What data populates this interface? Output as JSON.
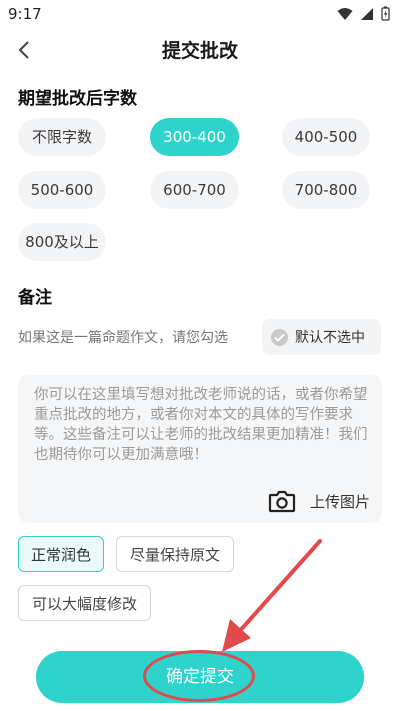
{
  "status_bar": {
    "time": "9:17"
  },
  "header": {
    "title": "提交批改"
  },
  "word_count": {
    "title": "期望批改后字数",
    "options": [
      "不限字数",
      "300-400",
      "400-500",
      "500-600",
      "600-700",
      "700-800",
      "800及以上"
    ],
    "selected": "300-400"
  },
  "notes": {
    "title": "备注",
    "hint": "如果这是一篇命题作文，请您勾选",
    "default_toggle_label": "默认不选中",
    "placeholder": "你可以在这里填写想对批改老师说的话，或者你希望重点批改的地方，或者你对本文的具体的写作要求等。这些备注可以让老师的批改结果更加精准！我们也期待你可以更加满意哦！",
    "upload_label": "上传图片"
  },
  "edit_style": {
    "options": [
      "正常润色",
      "尽量保持原文",
      "可以大幅度修改"
    ],
    "selected": "正常润色"
  },
  "submit_label": "确定提交",
  "colors": {
    "accent": "#2ed3cc",
    "annotation": "#e04a4a"
  }
}
